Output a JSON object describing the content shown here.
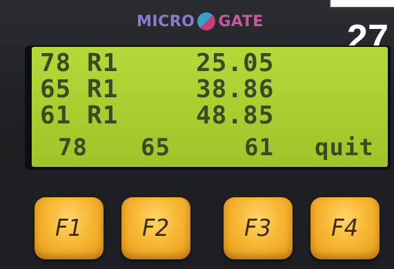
{
  "brand": {
    "text_left": "MICRO",
    "text_right": "GATE"
  },
  "badge": "27",
  "display": {
    "rows": [
      {
        "bib": "78",
        "run": "R1",
        "time": "25.05"
      },
      {
        "bib": "65",
        "run": "R1",
        "time": "38.86"
      },
      {
        "bib": "61",
        "run": "R1",
        "time": "48.85"
      }
    ],
    "softkeys": [
      "78",
      "65",
      "61",
      "quit"
    ]
  },
  "keys": [
    "F1",
    "F2",
    "F3",
    "F4"
  ],
  "colors": {
    "lcd": "#a9cd2f",
    "lcd_text": "#3a4a22",
    "key": "#f7b733"
  }
}
